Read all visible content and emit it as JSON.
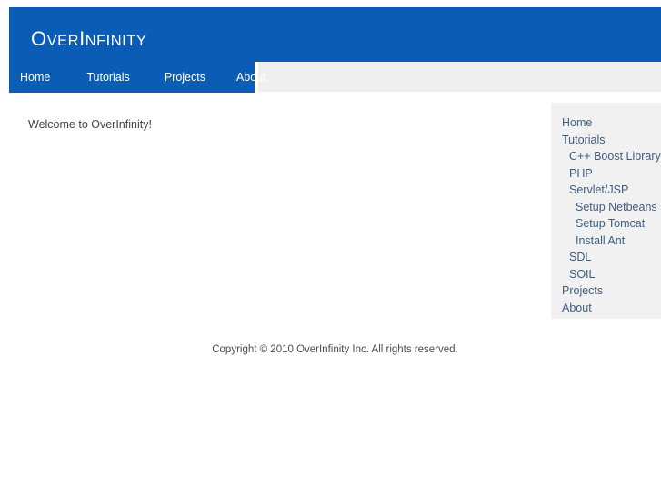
{
  "site": {
    "logo_cap_1": "O",
    "logo_small_1": "VER",
    "logo_cap_2": "I",
    "logo_small_2": "NFINITY",
    "logo_full": "OverInfinity"
  },
  "colors": {
    "brand_blue": "#0a5cb5",
    "nav_strip_gray": "#efefef",
    "sidebar_gray": "#f1f1f1",
    "sidebar_text": "#3f5d80",
    "body_text": "#444444",
    "page_background": "#ffffff"
  },
  "nav": {
    "items": [
      {
        "label": "Home"
      },
      {
        "label": "Tutorials"
      },
      {
        "label": "Projects"
      },
      {
        "label": "About"
      }
    ]
  },
  "main": {
    "welcome": "Welcome to OverInfinity!"
  },
  "sidebar": {
    "items": [
      {
        "label": "Home",
        "level": 0
      },
      {
        "label": "Tutorials",
        "level": 0
      },
      {
        "label": "C++ Boost Library",
        "level": 1
      },
      {
        "label": "PHP",
        "level": 1
      },
      {
        "label": "Servlet/JSP",
        "level": 1
      },
      {
        "label": "Setup Netbeans",
        "level": 2
      },
      {
        "label": "Setup Tomcat",
        "level": 2
      },
      {
        "label": "Install Ant",
        "level": 2
      },
      {
        "label": "SDL",
        "level": 1
      },
      {
        "label": "SOIL",
        "level": 1
      },
      {
        "label": "Projects",
        "level": 0
      },
      {
        "label": "About",
        "level": 0
      }
    ]
  },
  "footer": {
    "copyright": "Copyright © 2010 OverInfinity Inc. All rights reserved."
  }
}
